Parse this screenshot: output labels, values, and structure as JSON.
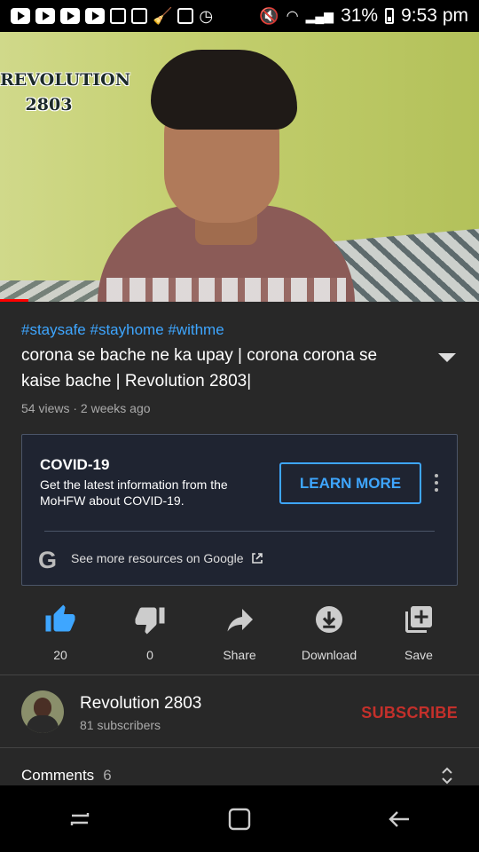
{
  "status_bar": {
    "battery": "31%",
    "time": "9:53 pm",
    "notification_icons": [
      "youtube-icon",
      "youtube-icon",
      "youtube-icon",
      "youtube-icon",
      "user-badge-icon",
      "image-icon",
      "broom-icon",
      "user-badge-icon",
      "clock-icon"
    ]
  },
  "video": {
    "watermark": "REVOLUTION 2803",
    "progress_fraction": 0.06
  },
  "info": {
    "hashtags": "#staysafe #stayhome #withme",
    "title": "corona se bache ne ka upay | corona corona se kaise bache | Revolution 2803|",
    "meta": "54 views · 2 weeks ago"
  },
  "covid_card": {
    "title": "COVID-19",
    "description": "Get the latest information from the MoHFW about COVID-19.",
    "button": "LEARN MORE",
    "resources_link": "See more resources on Google"
  },
  "actions": [
    {
      "icon": "thumbs-up-icon",
      "label": "20",
      "active": true
    },
    {
      "icon": "thumbs-down-icon",
      "label": "0",
      "active": false
    },
    {
      "icon": "share-icon",
      "label": "Share",
      "active": false
    },
    {
      "icon": "download-icon",
      "label": "Download",
      "active": false
    },
    {
      "icon": "save-playlist-icon",
      "label": "Save",
      "active": false
    }
  ],
  "channel": {
    "name": "Revolution 2803",
    "subscribers": "81 subscribers",
    "subscribe_label": "SUBSCRIBE"
  },
  "comments": {
    "label": "Comments",
    "count": "6"
  },
  "colors": {
    "accent_blue": "#3ea6ff",
    "subscribe_red": "#c4302b",
    "background": "#282828"
  }
}
